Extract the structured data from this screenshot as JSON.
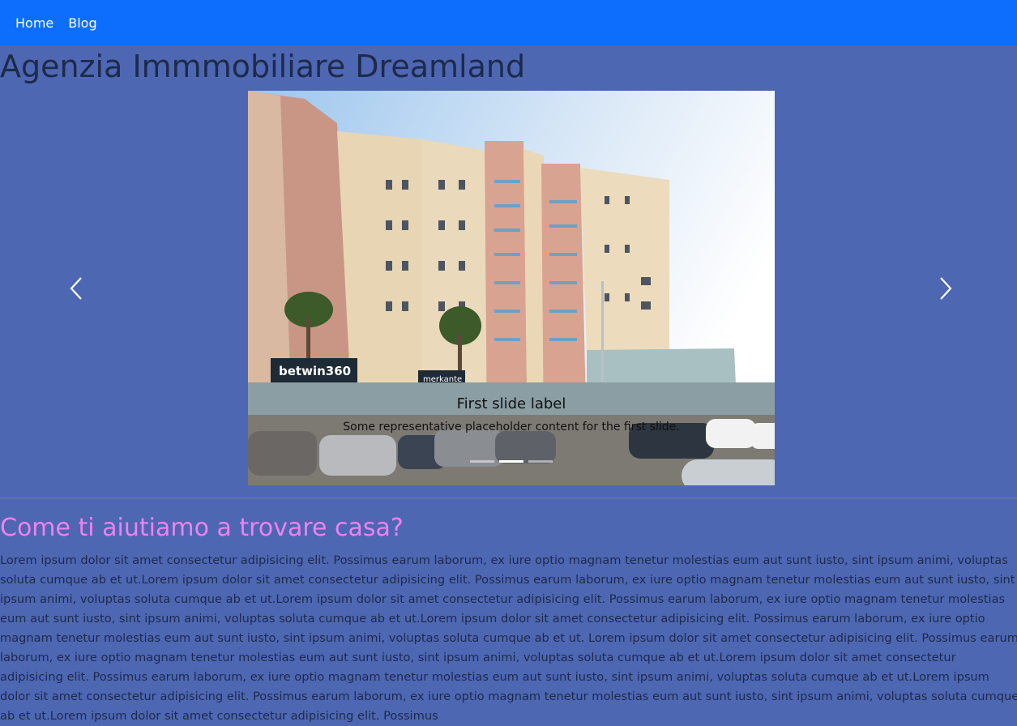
{
  "nav": {
    "links": [
      "Home",
      "Blog"
    ]
  },
  "header": {
    "title": "Agenzia Immmobiliare Dreamland"
  },
  "carousel": {
    "slide": {
      "title": "First slide label",
      "text": "Some representative placeholder content for the first slide."
    },
    "prev_icon": "chevron-left-icon",
    "next_icon": "chevron-right-icon",
    "indicator_count": 3,
    "active_index": 1,
    "signs": {
      "sign1": "betwin360",
      "sign2": "merkante"
    }
  },
  "section": {
    "title": "Come ti aiutiamo a trovare casa?",
    "body": "Lorem ipsum dolor sit amet consectetur adipisicing elit. Possimus earum laborum, ex iure optio magnam tenetur molestias eum aut sunt iusto, sint ipsum animi, voluptas soluta cumque ab et ut.Lorem ipsum dolor sit amet consectetur adipisicing elit. Possimus earum laborum, ex iure optio magnam tenetur molestias eum aut sunt iusto, sint ipsum animi, voluptas soluta cumque ab et ut.Lorem ipsum dolor sit amet consectetur adipisicing elit. Possimus earum laborum, ex iure optio magnam tenetur molestias eum aut sunt iusto, sint ipsum animi, voluptas soluta cumque ab et ut.Lorem ipsum dolor sit amet consectetur adipisicing elit. Possimus earum laborum, ex iure optio magnam tenetur molestias eum aut sunt iusto, sint ipsum animi, voluptas soluta cumque ab et ut. Lorem ipsum dolor sit amet consectetur adipisicing elit. Possimus earum laborum, ex iure optio magnam tenetur molestias eum aut sunt iusto, sint ipsum animi, voluptas soluta cumque ab et ut.Lorem ipsum dolor sit amet consectetur adipisicing elit. Possimus earum laborum, ex iure optio magnam tenetur molestias eum aut sunt iusto, sint ipsum animi, voluptas soluta cumque ab et ut.Lorem ipsum dolor sit amet consectetur adipisicing elit. Possimus earum laborum, ex iure optio magnam tenetur molestias eum aut sunt iusto, sint ipsum animi, voluptas soluta cumque ab et ut.Lorem ipsum dolor sit amet consectetur adipisicing elit. Possimus"
  },
  "colors": {
    "navbar": "#0d6efd",
    "page_background": "#4d67b3",
    "section_title": "#ee82ee",
    "text": "#1e2a4a"
  }
}
